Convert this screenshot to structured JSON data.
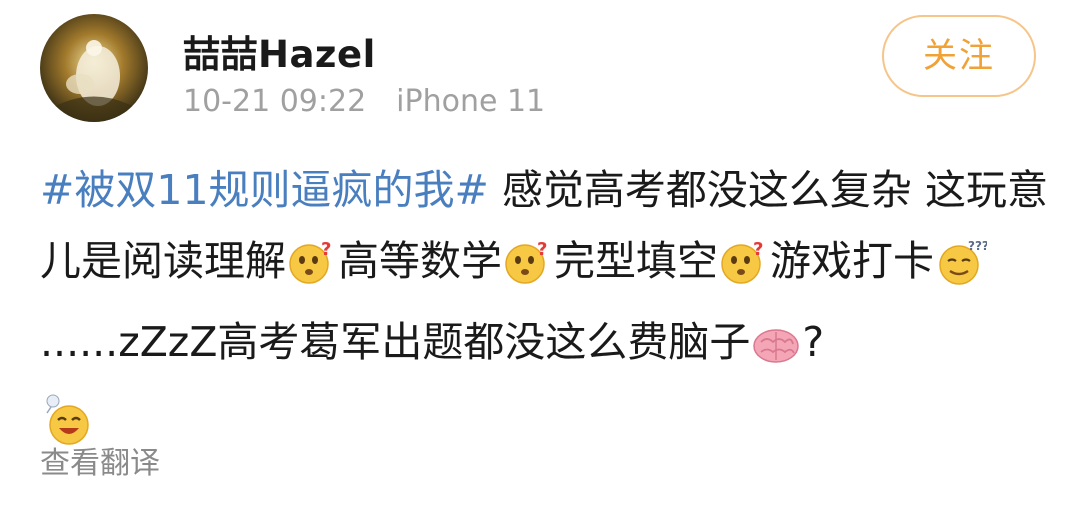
{
  "user": {
    "name": "喆喆Hazel",
    "time": "10-21 09:22",
    "device": "iPhone 11"
  },
  "follow_button": {
    "label": "关注"
  },
  "post": {
    "hashtag": "#被双11规则逼疯的我#",
    "seg1": " 感觉高考都没这么复杂 这玩意儿是阅读理解",
    "seg2": "高等数学",
    "seg3": "完型填空",
    "seg4": "游戏打卡",
    "seg5": "......zZzZ高考葛军出题都没这么费脑子",
    "seg6": "?"
  },
  "translate": {
    "label": "查看翻译"
  },
  "colors": {
    "link": "#4a7fbf",
    "follow": "#f0a236",
    "follow_border": "#f5c58a",
    "meta": "#a0a0a0"
  },
  "icons": [
    "confused-emoji-icon",
    "sleepy-emoji-icon",
    "brain-emoji-icon",
    "sweat-laugh-emoji-icon"
  ]
}
